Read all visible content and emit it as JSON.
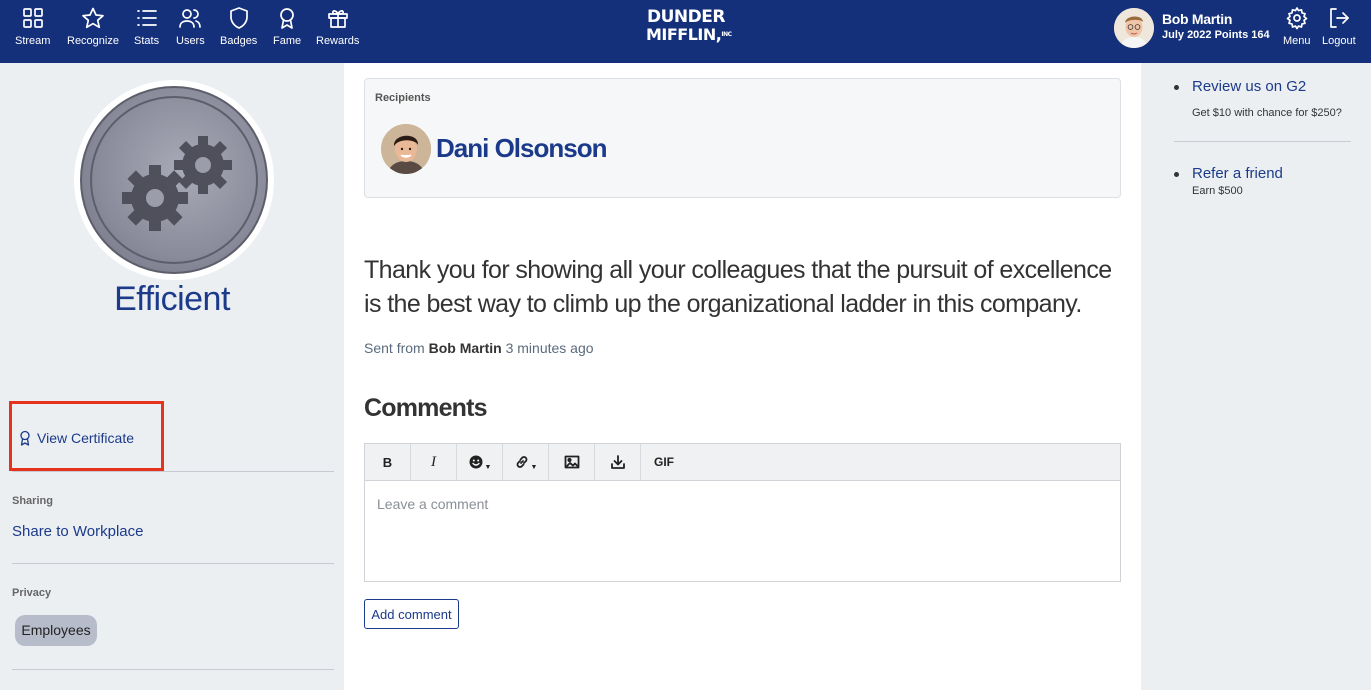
{
  "nav": {
    "items": [
      {
        "label": "Stream",
        "icon": "grid-icon"
      },
      {
        "label": "Recognize",
        "icon": "star-icon"
      },
      {
        "label": "Stats",
        "icon": "list-icon"
      },
      {
        "label": "Users",
        "icon": "users-icon"
      },
      {
        "label": "Badges",
        "icon": "shield-icon"
      },
      {
        "label": "Fame",
        "icon": "award-icon"
      },
      {
        "label": "Rewards",
        "icon": "gift-icon"
      }
    ],
    "logo_line1": "DUNDER",
    "logo_line2": "MIFFLIN,",
    "logo_inc": "INC",
    "user_name": "Bob Martin",
    "user_points": "July 2022 Points 164",
    "menu_label": "Menu",
    "logout_label": "Logout"
  },
  "badge": {
    "title": "Efficient",
    "view_certificate": "View Certificate"
  },
  "sharing": {
    "label": "Sharing",
    "share_link": "Share to Workplace"
  },
  "privacy": {
    "label": "Privacy",
    "value": "Employees"
  },
  "recognition": {
    "recipients_label": "Recipients",
    "recipient_name": "Dani Olsonson",
    "message": "Thank you for showing all your colleagues that the pursuit of excellence is the best way to climb up the organizational ladder in this company.",
    "sent_prefix": "Sent from",
    "sender": "Bob Martin",
    "time_ago": "3 minutes ago"
  },
  "comments": {
    "heading": "Comments",
    "toolbar": {
      "bold": "B",
      "italic": "I",
      "gif": "GIF"
    },
    "placeholder": "Leave a comment",
    "add_button": "Add comment"
  },
  "promos": [
    {
      "title": "Review us on G2",
      "subtitle": "Get $10 with chance for $250?"
    },
    {
      "title": "Refer a friend",
      "subtitle": "Earn $500"
    }
  ],
  "colors": {
    "nav_bg": "#14307a",
    "accent": "#1b3a8a",
    "highlight_box": "#e8321e",
    "sidebar_bg": "#eceff2"
  }
}
